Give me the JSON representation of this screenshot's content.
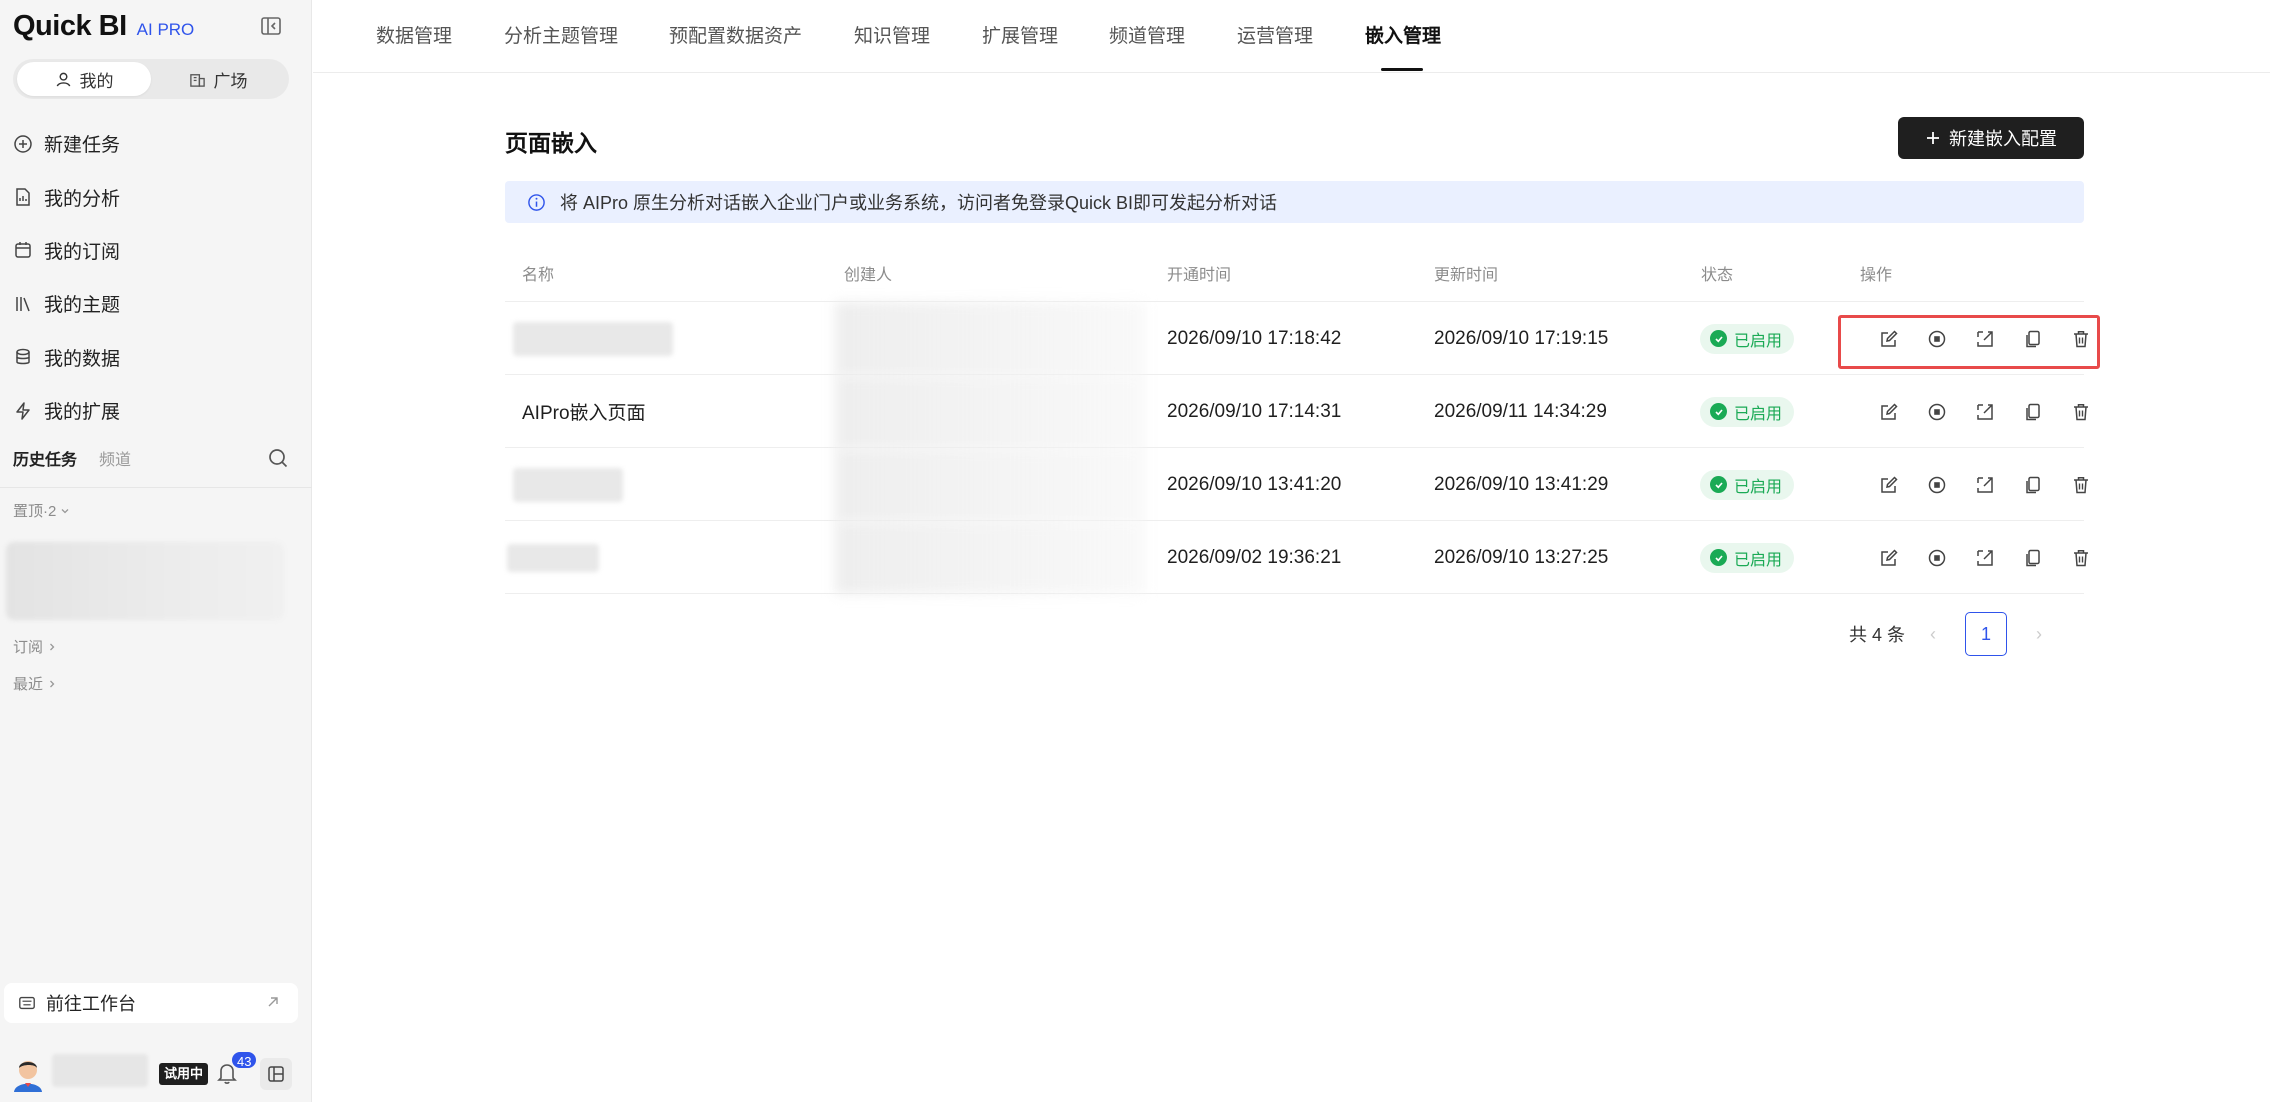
{
  "brand": {
    "name": "Quick BI",
    "sub": "AI PRO"
  },
  "sidebar": {
    "segments": [
      {
        "label": "我的",
        "icon": "user-icon"
      },
      {
        "label": "广场",
        "icon": "building-icon"
      }
    ],
    "nav": [
      {
        "label": "新建任务",
        "icon": "plus-circle-icon"
      },
      {
        "label": "我的分析",
        "icon": "document-chart-icon"
      },
      {
        "label": "我的订阅",
        "icon": "calendar-icon"
      },
      {
        "label": "我的主题",
        "icon": "books-icon"
      },
      {
        "label": "我的数据",
        "icon": "database-icon"
      },
      {
        "label": "我的扩展",
        "icon": "lightning-icon"
      }
    ],
    "history_tabs": [
      "历史任务",
      "频道"
    ],
    "groups": {
      "pinned": "置顶·2",
      "subscribe": "订阅",
      "recent": "最近"
    },
    "workbench": "前往工作台",
    "user": {
      "trial": "试用中",
      "notifications": "43"
    }
  },
  "top_tabs": [
    "数据管理",
    "分析主题管理",
    "预配置数据资产",
    "知识管理",
    "扩展管理",
    "频道管理",
    "运营管理",
    "嵌入管理"
  ],
  "active_tab": "嵌入管理",
  "main": {
    "title": "页面嵌入",
    "new_button": "新建嵌入配置",
    "info": "将 AIPro 原生分析对话嵌入企业门户或业务系统，访问者免登录Quick BI即可发起分析对话",
    "columns": [
      "名称",
      "创建人",
      "开通时间",
      "更新时间",
      "状态",
      "操作"
    ],
    "rows": [
      {
        "name": "",
        "opened": "2026/09/10 17:18:42",
        "updated": "2026/09/10 17:19:15",
        "status": "已启用"
      },
      {
        "name": "AIPro嵌入页面",
        "opened": "2026/09/10 17:14:31",
        "updated": "2026/09/11 14:34:29",
        "status": "已启用"
      },
      {
        "name": "",
        "opened": "2026/09/10 13:41:20",
        "updated": "2026/09/10 13:41:29",
        "status": "已启用"
      },
      {
        "name": "",
        "opened": "2026/09/02 19:36:21",
        "updated": "2026/09/10 13:27:25",
        "status": "已启用"
      }
    ],
    "actions": [
      "edit-icon",
      "stop-icon",
      "share-icon",
      "copy-icon",
      "delete-icon"
    ],
    "pagination": {
      "total": "共 4 条",
      "current": "1"
    }
  },
  "colors": {
    "accent": "#2f54eb",
    "success": "#1aaa55",
    "highlight": "#e84a4a",
    "info_bg": "#eaf0ff"
  }
}
